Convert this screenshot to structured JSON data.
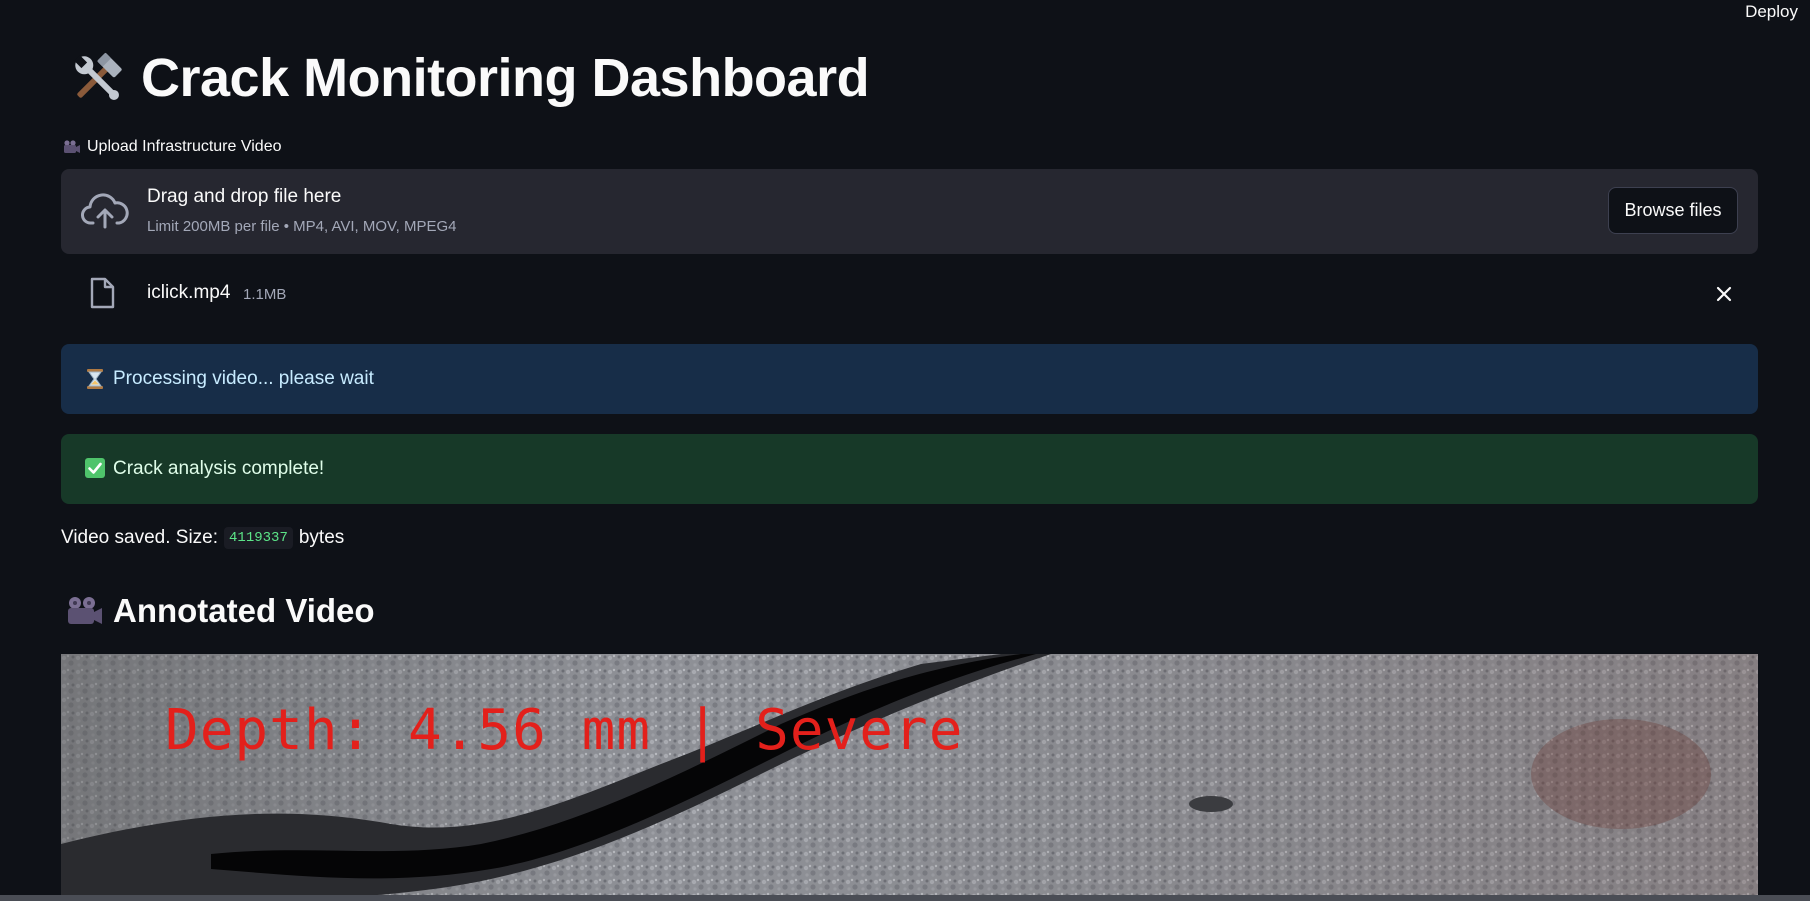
{
  "header": {
    "deploy_label": "Deploy"
  },
  "page": {
    "title": "Crack Monitoring Dashboard",
    "title_icon": "hammer-and-wrench-emoji"
  },
  "uploader": {
    "label": "Upload Infrastructure Video",
    "label_icon": "movie-camera-emoji",
    "dropzone_title": "Drag and drop file here",
    "dropzone_subtitle": "Limit 200MB per file • MP4, AVI, MOV, MPEG4",
    "browse_label": "Browse files",
    "uploaded_file": {
      "name": "iclick.mp4",
      "size": "1.1MB"
    }
  },
  "alerts": {
    "info": {
      "text": "Processing video... please wait",
      "icon": "hourglass-emoji"
    },
    "success": {
      "text": "Crack analysis complete!",
      "icon": "check-mark-button-emoji"
    }
  },
  "saved": {
    "prefix": "Video saved. Size:",
    "value": "4119337",
    "suffix": "bytes"
  },
  "annotated": {
    "title": "Annotated Video",
    "icon": "movie-camera-emoji",
    "overlay_text": "Depth: 4.56 mm | Severe"
  },
  "colors": {
    "background": "#0e1117",
    "panel": "#262730",
    "info_bg": "#172d48",
    "success_bg": "#173928",
    "overlay_red": "#e3201b",
    "code_green": "#5ce488"
  }
}
